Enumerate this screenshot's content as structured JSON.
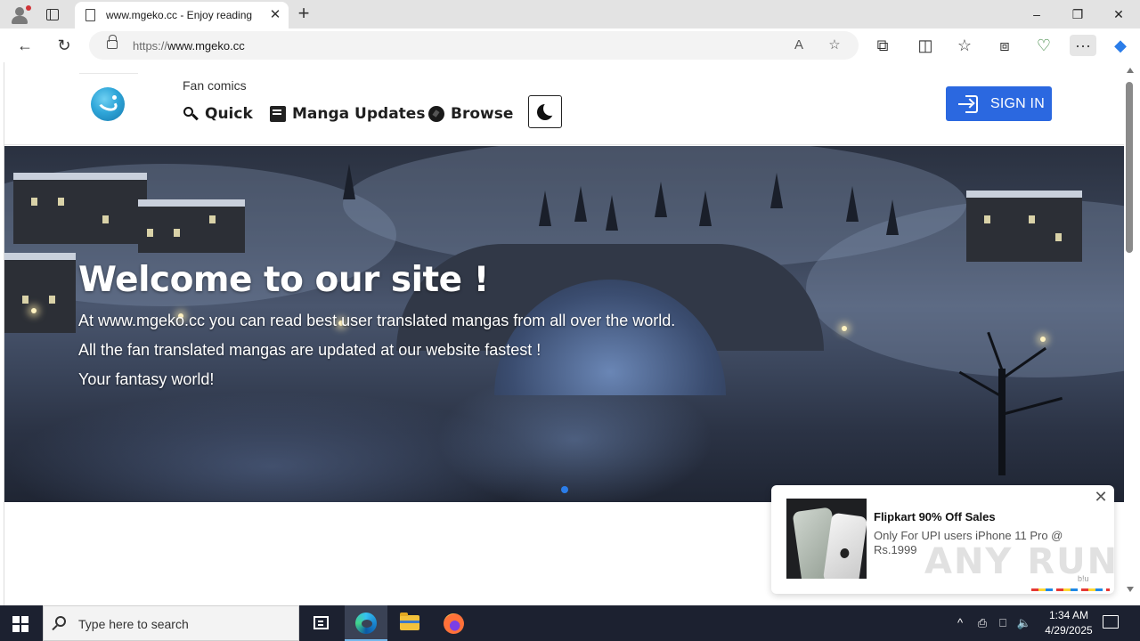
{
  "browser": {
    "tab_title": "www.mgeko.cc - Enjoy reading",
    "tab_close_glyph": "✕",
    "new_tab_glyph": "+",
    "address": {
      "scheme": "https://",
      "host": "www.mgeko.cc"
    },
    "window_controls": {
      "minimize": "–",
      "restore": "❐",
      "close": "✕"
    },
    "toolbar_icons": {
      "back": "←",
      "refresh": "↻",
      "read_aloud": "A",
      "favorite": "☆",
      "extensions": "⧉",
      "split_screen": "◫",
      "favorites": "☆",
      "collections": "⧈",
      "browser_essentials": "♡",
      "more": "···",
      "copilot": "◆"
    }
  },
  "site": {
    "tagline": "Fan comics",
    "nav": [
      {
        "label": "Quick",
        "icon": "search-icon"
      },
      {
        "label": "Manga Updates",
        "icon": "book-icon"
      },
      {
        "label": "Browse",
        "icon": "compass-icon"
      }
    ],
    "theme_toggle_icon": "moon-icon",
    "sign_in_label": "SIGN IN",
    "hero": {
      "title": "Welcome to our site !",
      "lines": [
        "At www.mgeko.cc you can read best user translated mangas from all over the world.",
        "All the fan translated mangas are updated at our website fastest !",
        "Your fantasy world!"
      ],
      "carousel_active_index": 0
    }
  },
  "ad": {
    "title": "Flipkart 90% Off Sales",
    "text": "Only For UPI users iPhone 11 Pro @ Rs.1999",
    "brand": "b!u",
    "close_glyph": "✕"
  },
  "watermark": "ANY RUN",
  "taskbar": {
    "search_placeholder": "Type here to search",
    "time": "1:34 AM",
    "date": "4/29/2025",
    "tray": {
      "chevron": "^",
      "network": "⎕",
      "volume": "🔈"
    }
  },
  "colors": {
    "sign_in_bg": "#2b68e0",
    "carousel_dot": "#2b7de9",
    "taskbar_bg": "#1c2130"
  }
}
